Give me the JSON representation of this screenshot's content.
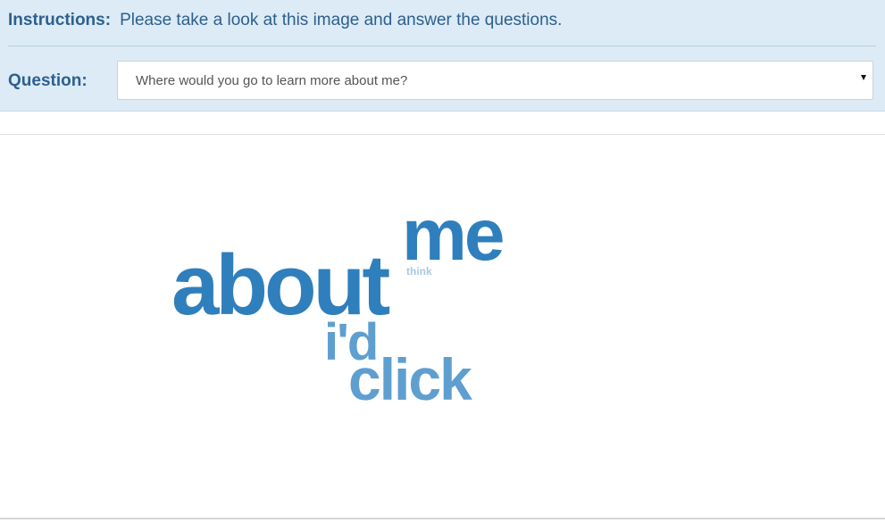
{
  "header": {
    "instructions_label": "Instructions:",
    "instructions_text": "Please take a look at this image and answer the questions.",
    "question_label": "Question:",
    "question_select": {
      "selected": "Where would you go to learn more about me?"
    }
  },
  "word_cloud": {
    "words": [
      {
        "text": "about",
        "color": "#2f7fbd"
      },
      {
        "text": "me",
        "color": "#2f7fbd"
      },
      {
        "text": "think",
        "color": "#a8c9e2"
      },
      {
        "text": "i'd",
        "color": "#5f9fd0"
      },
      {
        "text": "click",
        "color": "#5f9fd0"
      }
    ]
  },
  "colors": {
    "header_bg": "#dcebf5",
    "label_text": "#2e5f8f"
  }
}
